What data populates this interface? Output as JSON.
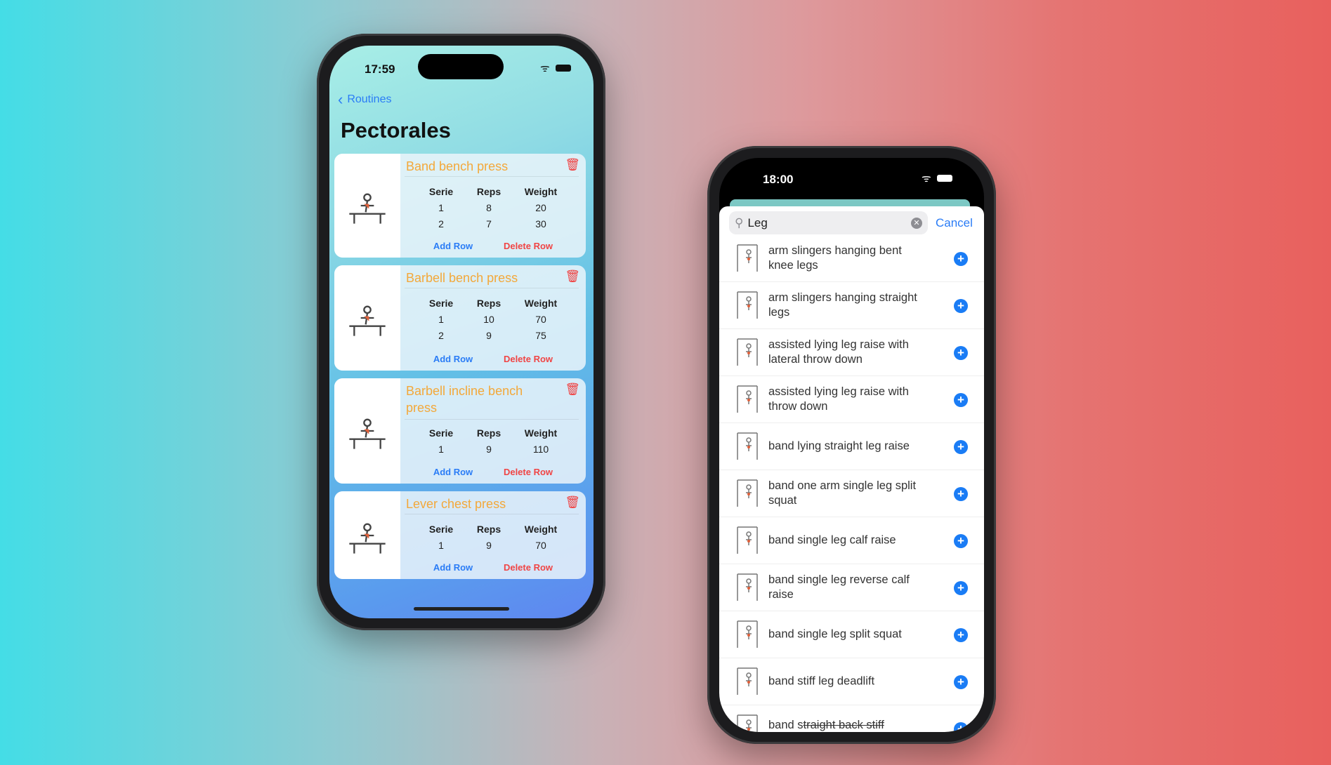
{
  "left_phone": {
    "status_time": "17:59",
    "back_label": "Routines",
    "page_title": "Pectorales",
    "column_headers": [
      "Serie",
      "Reps",
      "Weight"
    ],
    "add_row_label": "Add Row",
    "delete_row_label": "Delete Row",
    "exercises": [
      {
        "name": "Band bench press",
        "rows": [
          [
            "1",
            "8",
            "20"
          ],
          [
            "2",
            "7",
            "30"
          ]
        ]
      },
      {
        "name": "Barbell bench press",
        "rows": [
          [
            "1",
            "10",
            "70"
          ],
          [
            "2",
            "9",
            "75"
          ]
        ]
      },
      {
        "name": "Barbell incline bench press",
        "rows": [
          [
            "1",
            "9",
            "110"
          ]
        ]
      },
      {
        "name": "Lever chest press",
        "rows": [
          [
            "1",
            "9",
            "70"
          ]
        ]
      }
    ]
  },
  "right_phone": {
    "status_time": "18:00",
    "search_value": "Leg",
    "cancel_label": "Cancel",
    "results": [
      "arm slingers hanging bent knee legs",
      "arm slingers hanging straight legs",
      "assisted lying leg raise with lateral throw down",
      "assisted lying leg raise with throw down",
      "band lying straight leg raise",
      "band one arm single leg split squat",
      "band single leg calf raise",
      "band single leg reverse calf raise",
      "band single leg split squat",
      "band stiff leg deadlift"
    ],
    "last_partial": {
      "prefix": "band s",
      "struck": "traight back stiff"
    }
  },
  "colors": {
    "accent": "#2a7cf6",
    "exercise_title": "#f3a83a",
    "delete": "#f04545"
  }
}
